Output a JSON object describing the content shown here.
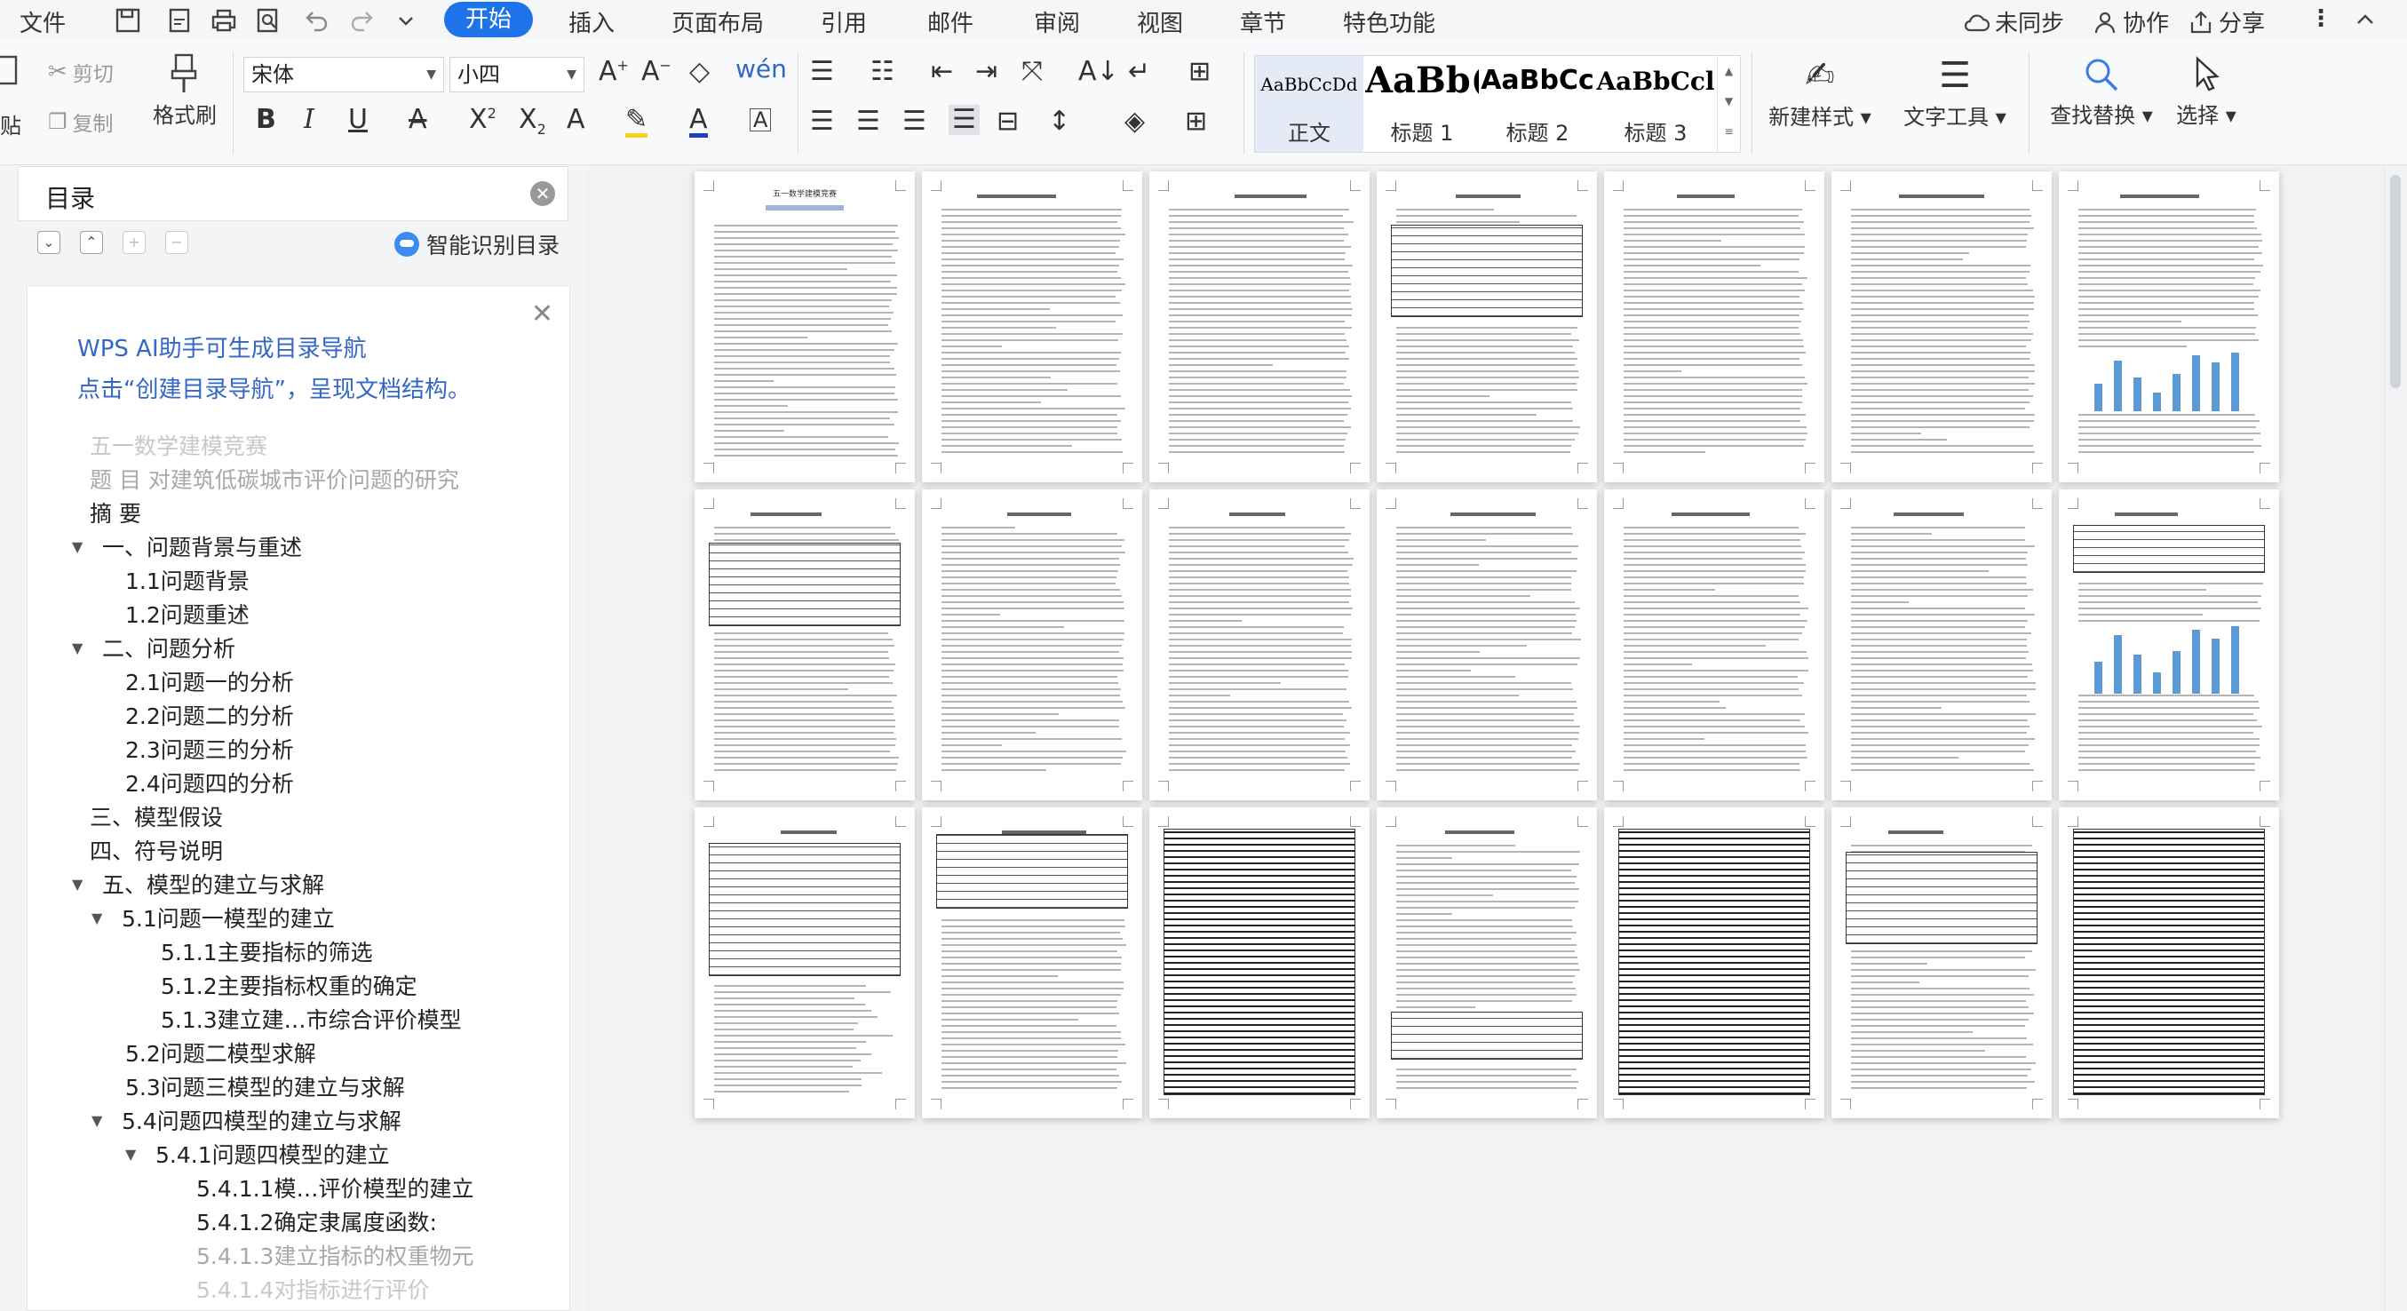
{
  "menu": {
    "file": "文件",
    "tabs": [
      "开始",
      "插入",
      "页面布局",
      "引用",
      "邮件",
      "审阅",
      "视图",
      "章节",
      "特色功能"
    ],
    "active_tab": "开始",
    "sync": "未同步",
    "collab": "协作",
    "share": "分享"
  },
  "ribbon": {
    "cut": "剪切",
    "copy": "复制",
    "format_painter": "格式刷",
    "paste_partial": "贴",
    "font_name": "宋体",
    "font_size": "小四",
    "styles": [
      {
        "sample": "AaBbCcDd",
        "name": "正文"
      },
      {
        "sample": "AaBb(",
        "name": "标题 1"
      },
      {
        "sample": "AaBbCc",
        "name": "标题 2"
      },
      {
        "sample": "AaBbCcl",
        "name": "标题 3"
      }
    ],
    "new_style": "新建样式",
    "text_tools": "文字工具",
    "find_replace": "查找替换",
    "select": "选择"
  },
  "toc": {
    "title": "目录",
    "ai_button": "智能识别目录",
    "tip_line1": "WPS AI助手可生成目录导航",
    "tip_line2": "点击“创建目录导航”，呈现文档结构。",
    "items": [
      {
        "text": "五一数学建模竞赛",
        "level": 0,
        "style": "faint",
        "arrow": ""
      },
      {
        "text": "题 目   对建筑低碳城市评价问题的研究",
        "level": 0,
        "style": "grey",
        "arrow": ""
      },
      {
        "text": "摘  要",
        "level": 0,
        "style": "",
        "arrow": ""
      },
      {
        "text": "一、问题背景与重述",
        "level": 0,
        "style": "",
        "arrow": "▼"
      },
      {
        "text": "1.1问题背景",
        "level": 1,
        "style": "",
        "arrow": ""
      },
      {
        "text": "1.2问题重述",
        "level": 1,
        "style": "",
        "arrow": ""
      },
      {
        "text": "二、问题分析",
        "level": 0,
        "style": "",
        "arrow": "▼"
      },
      {
        "text": "2.1问题一的分析",
        "level": 1,
        "style": "",
        "arrow": ""
      },
      {
        "text": "2.2问题二的分析",
        "level": 1,
        "style": "",
        "arrow": ""
      },
      {
        "text": "2.3问题三的分析",
        "level": 1,
        "style": "",
        "arrow": ""
      },
      {
        "text": "2.4问题四的分析",
        "level": 1,
        "style": "",
        "arrow": ""
      },
      {
        "text": "三、模型假设",
        "level": 0,
        "style": "",
        "arrow": ""
      },
      {
        "text": "四、符号说明",
        "level": 0,
        "style": "",
        "arrow": ""
      },
      {
        "text": "五、模型的建立与求解",
        "level": 0,
        "style": "",
        "arrow": "▼"
      },
      {
        "text": "5.1问题一模型的建立",
        "level": 1,
        "style": "",
        "arrow": "▼"
      },
      {
        "text": "5.1.1主要指标的筛选",
        "level": 2,
        "style": "",
        "arrow": ""
      },
      {
        "text": "5.1.2主要指标权重的确定",
        "level": 2,
        "style": "",
        "arrow": ""
      },
      {
        "text": "5.1.3建立建…市综合评价模型",
        "level": 2,
        "style": "",
        "arrow": ""
      },
      {
        "text": "5.2问题二模型求解",
        "level": 1,
        "style": "",
        "arrow": ""
      },
      {
        "text": "5.3问题三模型的建立与求解",
        "level": 1,
        "style": "",
        "arrow": ""
      },
      {
        "text": "5.4问题四模型的建立与求解",
        "level": 1,
        "style": "",
        "arrow": "▼"
      },
      {
        "text": "5.4.1问题四模型的建立",
        "level": 2,
        "style": "",
        "arrow": "▼"
      },
      {
        "text": "5.4.1.1模…评价模型的建立",
        "level": 3,
        "style": "",
        "arrow": ""
      },
      {
        "text": "5.4.1.2确定隶属度函数:",
        "level": 3,
        "style": "",
        "arrow": ""
      },
      {
        "text": "5.4.1.3建立指标的权重物元",
        "level": 3,
        "style": "grey",
        "arrow": ""
      },
      {
        "text": "5.4.1.4对指标进行评价",
        "level": 3,
        "style": "faint",
        "arrow": ""
      }
    ]
  },
  "pages": {
    "rows": 3,
    "cols": 7,
    "cover_title": "五一数学建模竞赛"
  }
}
